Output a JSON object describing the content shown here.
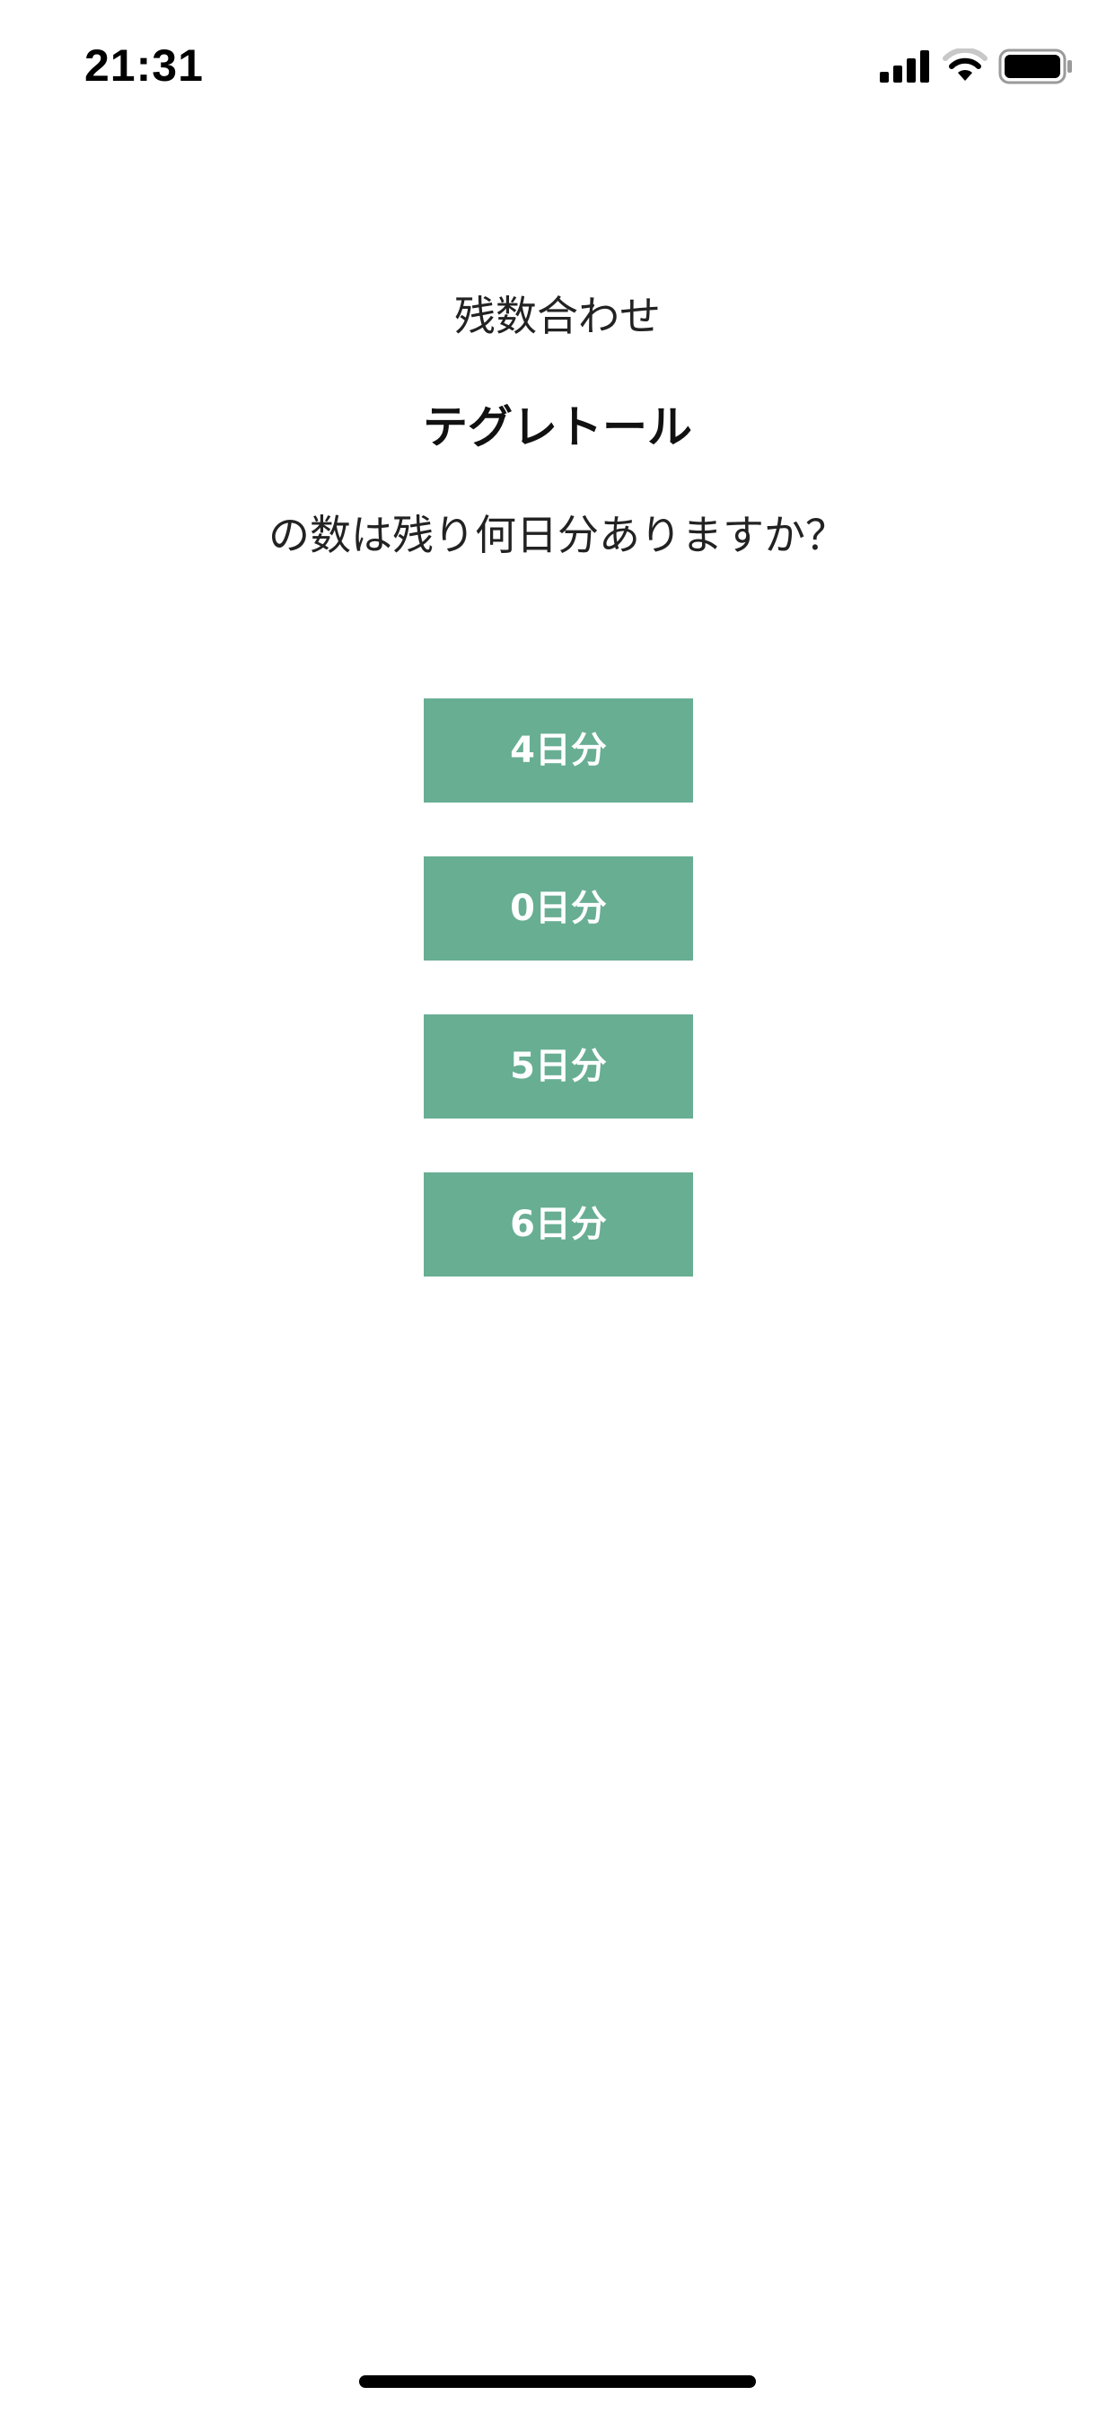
{
  "status_bar": {
    "time": "21:31",
    "icons": [
      "cellular-signal-icon",
      "wifi-icon",
      "battery-icon"
    ],
    "battery_level": 1.0
  },
  "quiz": {
    "mode_label": "残数合わせ",
    "medicine_name": "テグレトール",
    "question": "の数は残り何日分ありますか？",
    "options": [
      {
        "label": "4日分"
      },
      {
        "label": "0日分"
      },
      {
        "label": "5日分"
      },
      {
        "label": "6日分"
      }
    ]
  },
  "colors": {
    "button_background": "#68ae93",
    "button_text": "#ffffff",
    "page_background": "#ffffff"
  }
}
